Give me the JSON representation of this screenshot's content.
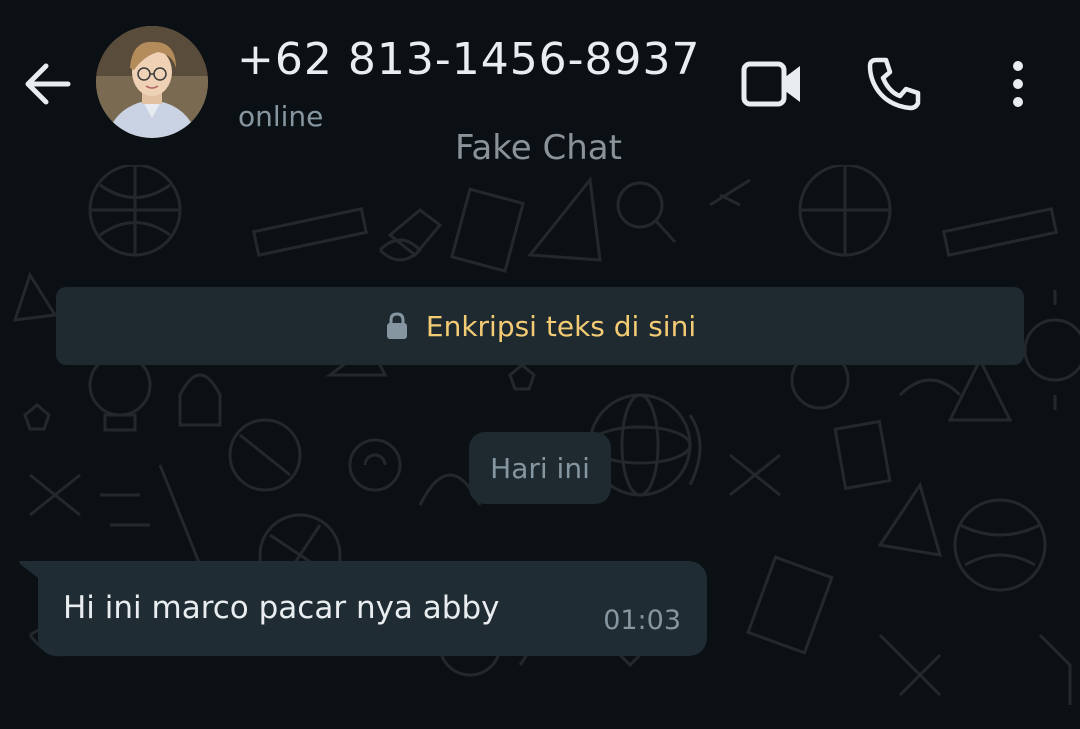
{
  "header": {
    "contact_name": "+62 813-1456-8937",
    "status": "online",
    "app_label": "Fake Chat",
    "icons": [
      "back-arrow-icon",
      "avatar",
      "video-call-icon",
      "voice-call-icon",
      "more-options-icon"
    ]
  },
  "encryption": {
    "text": "Enkripsi teks di sini",
    "icon": "lock-icon"
  },
  "date_chip": {
    "label": "Hari ini"
  },
  "messages": [
    {
      "direction": "incoming",
      "text": "Hi ini marco pacar nya abby",
      "time": "01:03"
    }
  ],
  "colors": {
    "background": "#0b1014",
    "bubble": "#1f2c33",
    "notice": "#1e2a30",
    "primary_text": "#e9edef",
    "secondary_text": "#8696a0",
    "encryption_text": "#f3cb74"
  }
}
